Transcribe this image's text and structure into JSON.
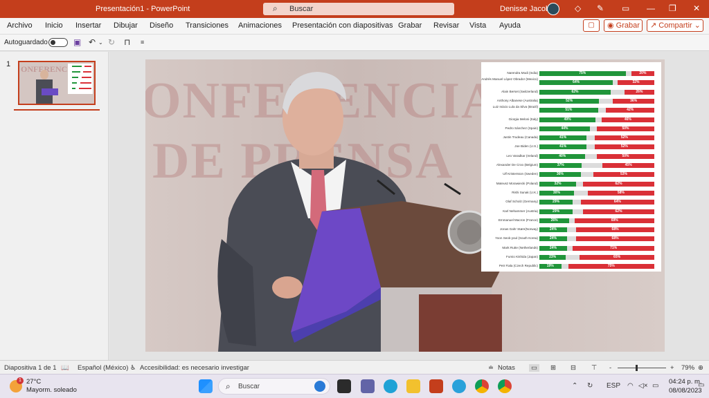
{
  "window": {
    "title": "Presentación1  -  PowerPoint",
    "search_text": "Buscar",
    "user_name": "Denisse Jacobo"
  },
  "menu": {
    "items": [
      "Archivo",
      "Inicio",
      "Insertar",
      "Dibujar",
      "Diseño",
      "Transiciones",
      "Animaciones",
      "Presentación con diapositivas",
      "Grabar",
      "Revisar",
      "Vista",
      "Ayuda"
    ],
    "record_label": "Grabar",
    "share_label": "Compartir"
  },
  "quickbar": {
    "autosave_label": "Autoguardado"
  },
  "thumbnails": {
    "slide_number": "1"
  },
  "slide": {
    "background_text_1": "ONFERENCIA",
    "background_text_2": "DE PRENSA"
  },
  "chart_data": {
    "type": "bar",
    "orientation": "horizontal-stacked",
    "series": [
      {
        "name": "",
        "color": "#20953a"
      },
      {
        "name": "",
        "color": "#da3037"
      }
    ],
    "rows": [
      {
        "leader": "Narendra Modi (India)",
        "approve": 75,
        "disapprove": 20
      },
      {
        "leader": "Andrés Manuel López Obrador (Mexico)",
        "approve": 64,
        "disapprove": 32
      },
      {
        "leader": "Alain Berset (Switzerland)",
        "approve": 62,
        "disapprove": 26
      },
      {
        "leader": "Anthony Albanese (Australia)",
        "approve": 52,
        "disapprove": 36
      },
      {
        "leader": "Luiz Inácio Lula da Silva (Brazil)",
        "approve": 51,
        "disapprove": 42
      },
      {
        "leader": "Giorgia Meloni (Italy)",
        "approve": 49,
        "disapprove": 46
      },
      {
        "leader": "Pedro Sánchez (Spain)",
        "approve": 44,
        "disapprove": 50
      },
      {
        "leader": "Justin Trudeau (Canada)",
        "approve": 41,
        "disapprove": 52
      },
      {
        "leader": "Joe Biden (U.S.)",
        "approve": 41,
        "disapprove": 52
      },
      {
        "leader": "Leo Varadkar (Ireland)",
        "approve": 40,
        "disapprove": 50
      },
      {
        "leader": "Alexander De Croo (Belgium)",
        "approve": 37,
        "disapprove": 45
      },
      {
        "leader": "Ulf Kristersson (Sweden)",
        "approve": 36,
        "disapprove": 53
      },
      {
        "leader": "Mateusz Morawiecki (Poland)",
        "approve": 32,
        "disapprove": 62
      },
      {
        "leader": "Rishi Sunak (U.K.)",
        "approve": 30,
        "disapprove": 58
      },
      {
        "leader": "Olaf Scholz (Germany)",
        "approve": 29,
        "disapprove": 64
      },
      {
        "leader": "Karl Nehammer (Austria)",
        "approve": 29,
        "disapprove": 62
      },
      {
        "leader": "Emmanuel Macron (France)",
        "approve": 26,
        "disapprove": 69
      },
      {
        "leader": "Jonas Gahr Støre(Norway)",
        "approve": 24,
        "disapprove": 68
      },
      {
        "leader": "Yoon Seok-youl (South Korea)",
        "approve": 24,
        "disapprove": 68
      },
      {
        "leader": "Mark Rutte (Netherlands)",
        "approve": 24,
        "disapprove": 71
      },
      {
        "leader": "Fumio Kishida (Japan)",
        "approve": 23,
        "disapprove": 65
      },
      {
        "leader": "Petr Fiala (Czech Republic)",
        "approve": 19,
        "disapprove": 75
      }
    ],
    "xlim": [
      0,
      100
    ]
  },
  "status": {
    "slide_info": "Diapositiva 1 de 1",
    "language": "Español (México)",
    "accessibility": "Accesibilidad: es necesario investigar",
    "notes_label": "Notas",
    "zoom_out": "-",
    "zoom_in": "+",
    "zoom_value": "79%"
  },
  "taskbar": {
    "weather_temp": "27°C",
    "weather_desc": "Mayorm. soleado",
    "weather_badge": "1",
    "search_text": "Buscar",
    "language": "ESP",
    "time": "04:24 p. m.",
    "date": "08/08/2023"
  }
}
